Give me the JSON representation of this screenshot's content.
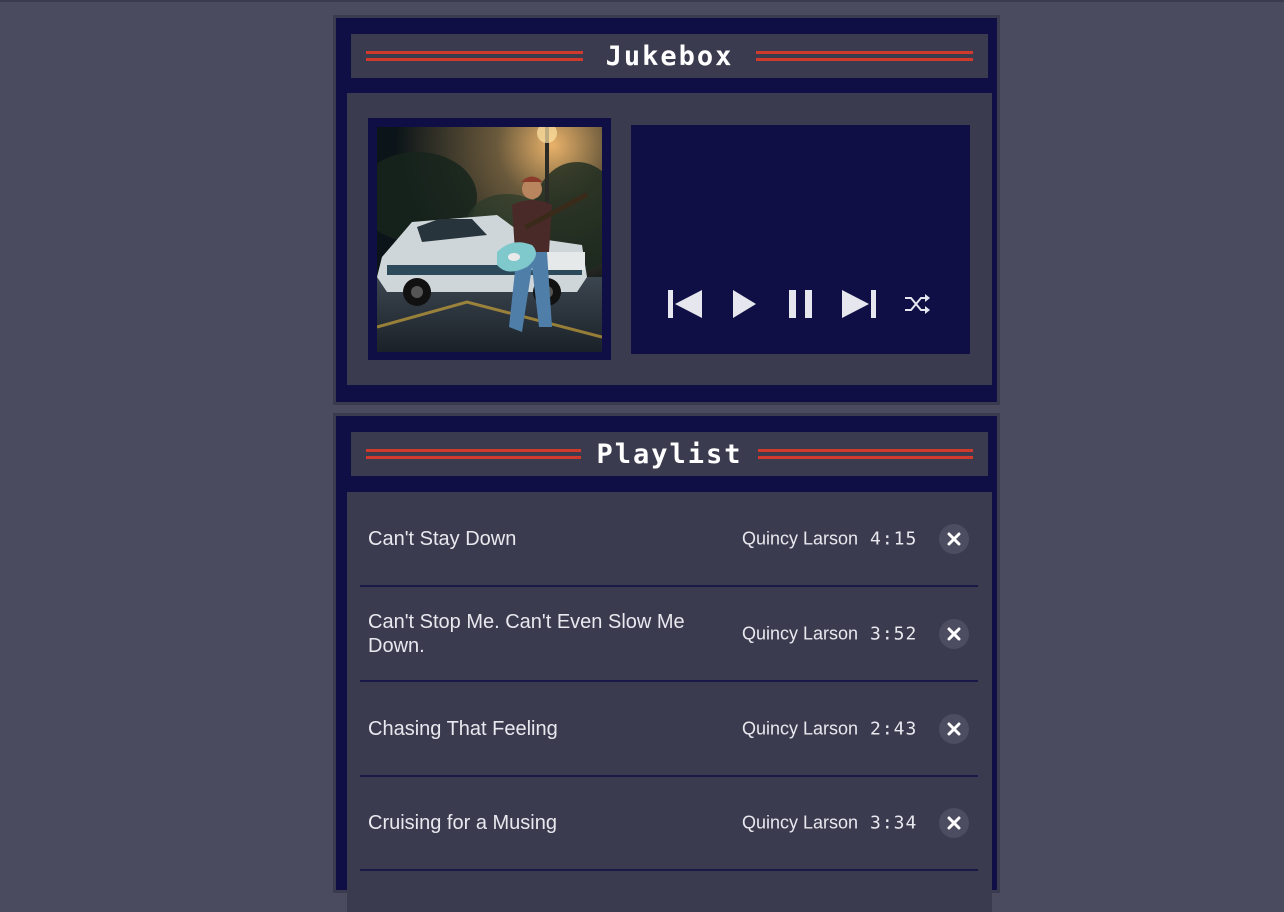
{
  "player": {
    "title": "Jukebox",
    "album_art_icon": "album-art-image",
    "controls": [
      {
        "name": "previous-button",
        "icon": "skip-previous-icon"
      },
      {
        "name": "play-button",
        "icon": "play-icon"
      },
      {
        "name": "pause-button",
        "icon": "pause-icon"
      },
      {
        "name": "next-button",
        "icon": "skip-next-icon"
      },
      {
        "name": "shuffle-button",
        "icon": "shuffle-icon"
      }
    ]
  },
  "playlist": {
    "title": "Playlist",
    "songs": [
      {
        "title": "Can't Stay Down",
        "artist": "Quincy Larson",
        "duration": "4:15"
      },
      {
        "title": "Can't Stop Me. Can't Even Slow Me Down.",
        "artist": "Quincy Larson",
        "duration": "3:52"
      },
      {
        "title": "Chasing That Feeling",
        "artist": "Quincy Larson",
        "duration": "2:43"
      },
      {
        "title": "Cruising for a Musing",
        "artist": "Quincy Larson",
        "duration": "3:34"
      }
    ]
  },
  "colors": {
    "background": "#4a4b5e",
    "panel": "#0f0f46",
    "panel_inner": "#3b3b4f",
    "accent_lines": "#d03a2c",
    "text": "#e8e8ef"
  }
}
